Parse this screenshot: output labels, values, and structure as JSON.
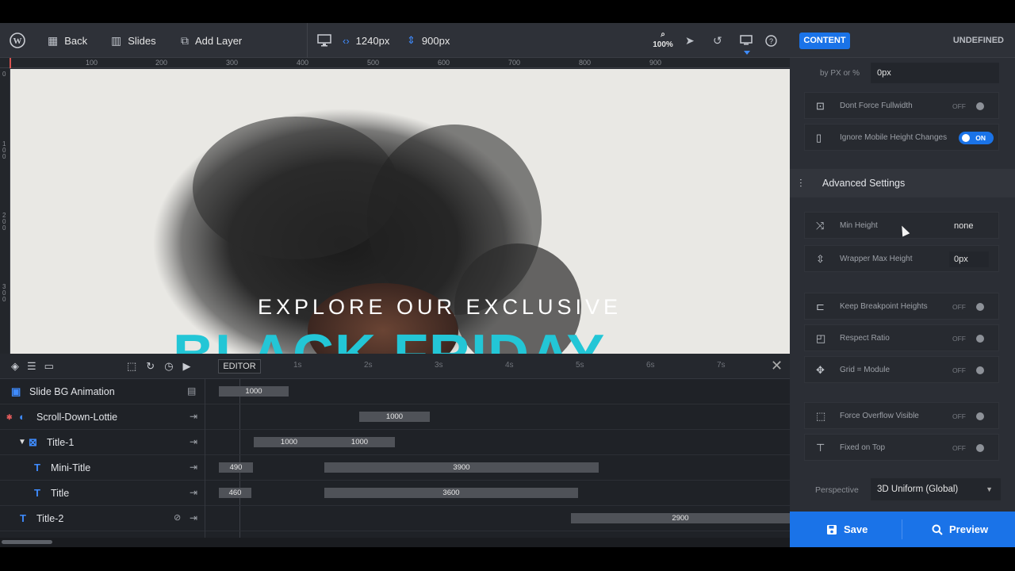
{
  "toolbar": {
    "back_label": "Back",
    "slides_label": "Slides",
    "add_layer_label": "Add Layer",
    "width_value": "1240px",
    "height_value": "900px",
    "zoom_label": "100%"
  },
  "ruler": {
    "h_ticks": [
      "100",
      "200",
      "300",
      "400",
      "500",
      "600",
      "700",
      "800",
      "900"
    ],
    "v_ticks": [
      "0",
      "100",
      "200",
      "300"
    ]
  },
  "canvas": {
    "mini_title": "EXPLORE OUR EXCLUSIVE",
    "title": "BLACK FRIDAY",
    "title_color": "#23c6d6"
  },
  "timeline": {
    "editor_label": "EDITOR",
    "seconds": [
      "1s",
      "2s",
      "3s",
      "4s",
      "5s",
      "6s",
      "7s"
    ],
    "layers": [
      {
        "name": "Slide BG Animation",
        "bars": [
          "1000"
        ]
      },
      {
        "name": "Scroll-Down-Lottie",
        "bars": [
          "1000"
        ]
      },
      {
        "name": "Title-1",
        "bars": [
          "1000",
          "1000"
        ]
      },
      {
        "name": "Mini-Title",
        "bars": [
          "490",
          "3900"
        ]
      },
      {
        "name": "Title",
        "bars": [
          "460",
          "3600"
        ]
      },
      {
        "name": "Title-2",
        "bars": [
          "2900"
        ]
      }
    ]
  },
  "panel": {
    "content_tab": "CONTENT",
    "undefined_tab": "UNDEFINED",
    "by_px_label": "by PX or %",
    "by_px_value": "0px",
    "dont_force_fullwidth": {
      "label": "Dont Force Fullwidth",
      "state": "OFF"
    },
    "ignore_mobile_height": {
      "label": "Ignore Mobile Height Changes",
      "state": "ON"
    },
    "advanced_settings": "Advanced Settings",
    "min_height": {
      "label": "Min Height",
      "value": "none"
    },
    "wrapper_max_height": {
      "label": "Wrapper Max Height",
      "value": "0px"
    },
    "keep_breakpoint_heights": {
      "label": "Keep Breakpoint Heights",
      "state": "OFF"
    },
    "respect_ratio": {
      "label": "Respect Ratio",
      "state": "OFF"
    },
    "grid_module": {
      "label": "Grid = Module",
      "state": "OFF"
    },
    "force_overflow_visible": {
      "label": "Force Overflow Visible",
      "state": "OFF"
    },
    "fixed_on_top": {
      "label": "Fixed on Top",
      "state": "OFF"
    },
    "perspective_label": "Perspective",
    "perspective_value": "3D Uniform (Global)",
    "save_label": "Save",
    "preview_label": "Preview"
  },
  "colors": {
    "accent": "#1a73e8",
    "canvas_bg": "#e9e8e4"
  }
}
